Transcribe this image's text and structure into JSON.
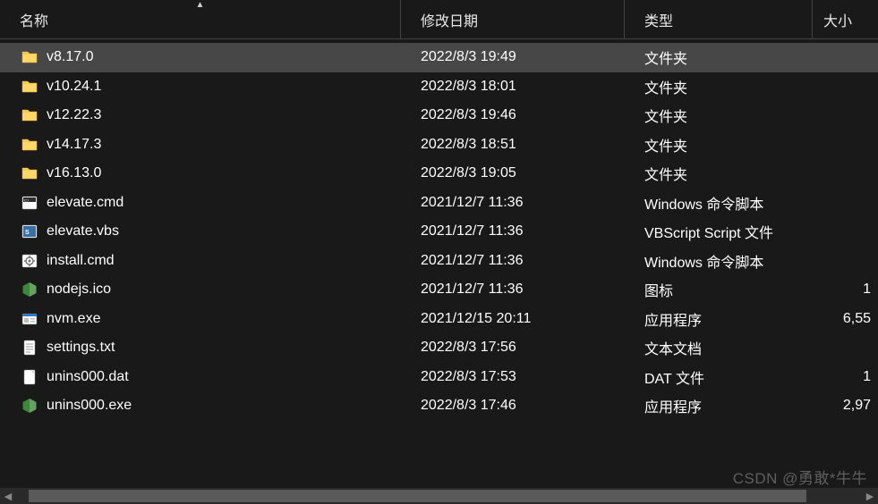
{
  "columns": {
    "name": "名称",
    "date": "修改日期",
    "type": "类型",
    "size": "大小"
  },
  "sort": {
    "column": "name",
    "direction": "asc"
  },
  "icons": {
    "folder": "folder-icon",
    "cmd": "cmd-icon",
    "vbs": "vbs-icon",
    "gear": "gear-icon",
    "nodejs": "nodejs-icon",
    "exe": "exe-icon",
    "txt": "txt-icon",
    "blank": "blank-file-icon"
  },
  "rows": [
    {
      "icon": "folder",
      "name": "v8.17.0",
      "date": "2022/8/3 19:49",
      "type": "文件夹",
      "size": "",
      "selected": true
    },
    {
      "icon": "folder",
      "name": "v10.24.1",
      "date": "2022/8/3 18:01",
      "type": "文件夹",
      "size": "",
      "selected": false
    },
    {
      "icon": "folder",
      "name": "v12.22.3",
      "date": "2022/8/3 19:46",
      "type": "文件夹",
      "size": "",
      "selected": false
    },
    {
      "icon": "folder",
      "name": "v14.17.3",
      "date": "2022/8/3 18:51",
      "type": "文件夹",
      "size": "",
      "selected": false
    },
    {
      "icon": "folder",
      "name": "v16.13.0",
      "date": "2022/8/3 19:05",
      "type": "文件夹",
      "size": "",
      "selected": false
    },
    {
      "icon": "cmd",
      "name": "elevate.cmd",
      "date": "2021/12/7 11:36",
      "type": "Windows 命令脚本",
      "size": "",
      "selected": false
    },
    {
      "icon": "vbs",
      "name": "elevate.vbs",
      "date": "2021/12/7 11:36",
      "type": "VBScript Script 文件",
      "size": "",
      "selected": false
    },
    {
      "icon": "gear",
      "name": "install.cmd",
      "date": "2021/12/7 11:36",
      "type": "Windows 命令脚本",
      "size": "",
      "selected": false
    },
    {
      "icon": "nodejs",
      "name": "nodejs.ico",
      "date": "2021/12/7 11:36",
      "type": "图标",
      "size": "1",
      "selected": false
    },
    {
      "icon": "exe",
      "name": "nvm.exe",
      "date": "2021/12/15 20:11",
      "type": "应用程序",
      "size": "6,55",
      "selected": false
    },
    {
      "icon": "txt",
      "name": "settings.txt",
      "date": "2022/8/3 17:56",
      "type": "文本文档",
      "size": "",
      "selected": false
    },
    {
      "icon": "blank",
      "name": "unins000.dat",
      "date": "2022/8/3 17:53",
      "type": "DAT 文件",
      "size": "1",
      "selected": false
    },
    {
      "icon": "nodejs",
      "name": "unins000.exe",
      "date": "2022/8/3 17:46",
      "type": "应用程序",
      "size": "2,97",
      "selected": false
    }
  ],
  "watermark": "CSDN @勇敢*牛牛"
}
